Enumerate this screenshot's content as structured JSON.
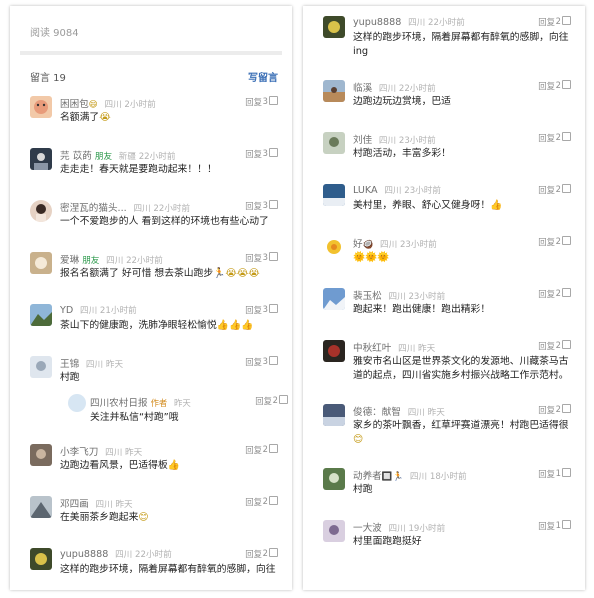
{
  "left": {
    "read_count": "阅读 9084",
    "comments_header": "留言 19",
    "write_label": "写留言",
    "comments": [
      {
        "name": "困困包",
        "name_emoji": "😄",
        "badge": "",
        "location": "四川",
        "time": "2小时前",
        "reply": "回复",
        "likes": "3",
        "text": "名额满了",
        "emoji": "😭"
      },
      {
        "name": "芫 苡菂",
        "name_emoji": "",
        "badge": "朋友",
        "location": "新疆",
        "time": "22小时前",
        "reply": "回复",
        "likes": "3",
        "text": "走走走！春天就是要跑动起来！！！",
        "emoji": ""
      },
      {
        "name": "密涅瓦的猫头...",
        "name_emoji": "",
        "badge": "",
        "location": "四川",
        "time": "22小时前",
        "reply": "回复",
        "likes": "3",
        "text": "一个不爱跑步的人 看到这样的环境也有些心动了",
        "emoji": ""
      },
      {
        "name": "爱琳",
        "name_emoji": "",
        "badge": "朋友",
        "location": "四川",
        "time": "22小时前",
        "reply": "回复",
        "likes": "3",
        "text": "报名名额满了 好可惜 想去茶山跑步",
        "emoji": "🏃😭😭😭"
      },
      {
        "name": "YD",
        "name_emoji": "",
        "badge": "",
        "location": "四川",
        "time": "21小时前",
        "reply": "回复",
        "likes": "3",
        "text": "茶山下的健康跑，洗肺净眼轻松愉悦",
        "emoji": "👍👍👍"
      },
      {
        "name": "王锦",
        "name_emoji": "",
        "badge": "",
        "location": "四川",
        "time": "昨天",
        "reply": "回复",
        "likes": "3",
        "text": "村跑",
        "emoji": ""
      },
      {
        "name": "小李飞刀",
        "name_emoji": "",
        "badge": "",
        "location": "四川",
        "time": "昨天",
        "reply": "回复",
        "likes": "2",
        "text": "边跑边看风景，巴适得板",
        "emoji": "👍"
      },
      {
        "name": "邓四画",
        "name_emoji": "",
        "badge": "",
        "location": "四川",
        "time": "昨天",
        "reply": "回复",
        "likes": "2",
        "text": "在美丽茶乡跑起来",
        "emoji": "😊"
      },
      {
        "name": "yupu8888",
        "name_emoji": "",
        "badge": "",
        "location": "四川",
        "time": "22小时前",
        "reply": "回复",
        "likes": "2",
        "text": "这样的跑步环境，隔着屏幕都有醉氧的感脚，向往",
        "emoji": ""
      }
    ],
    "subreply": {
      "name": "四川农村日报",
      "badge": "作者",
      "time": "昨天",
      "reply": "回复",
      "likes": "2",
      "text": "关注并私信“村跑”哦"
    }
  },
  "right": {
    "comments": [
      {
        "name": "yupu8888",
        "name_emoji": "",
        "badge": "",
        "location": "四川",
        "time": "22小时前",
        "reply": "回复",
        "likes": "2",
        "text": "这样的跑步环境，隔着屏幕都有醉氧的感脚，向往ing",
        "emoji": ""
      },
      {
        "name": "临溪",
        "name_emoji": "",
        "badge": "",
        "location": "四川",
        "time": "22小时前",
        "reply": "回复",
        "likes": "2",
        "text": "边跑边玩边赏境，巴适",
        "emoji": ""
      },
      {
        "name": "刘佳",
        "name_emoji": "",
        "badge": "",
        "location": "四川",
        "time": "23小时前",
        "reply": "回复",
        "likes": "2",
        "text": "村跑活动，丰富多彩！",
        "emoji": ""
      },
      {
        "name": "LUKA",
        "name_emoji": "",
        "badge": "",
        "location": "四川",
        "time": "23小时前",
        "reply": "回复",
        "likes": "2",
        "text": "美村里，养眼、舒心又健身呀！",
        "emoji": "👍"
      },
      {
        "name": "好",
        "name_emoji": "🥥",
        "badge": "",
        "location": "四川",
        "time": "23小时前",
        "reply": "回复",
        "likes": "2",
        "text": "",
        "emoji": "🌞🌞🌞"
      },
      {
        "name": "裴玉松",
        "name_emoji": "",
        "badge": "",
        "location": "四川",
        "time": "23小时前",
        "reply": "回复",
        "likes": "2",
        "text": "跑起来！跑出健康！跑出精彩！",
        "emoji": ""
      },
      {
        "name": "中秋红叶",
        "name_emoji": "",
        "badge": "",
        "location": "四川",
        "time": "昨天",
        "reply": "回复",
        "likes": "2",
        "text": "雅安市名山区是世界茶文化的发源地、川藏茶马古道的起点，四川省实施乡村振兴战略工作示范村。",
        "emoji": ""
      },
      {
        "name": "俊德：献智",
        "name_emoji": "",
        "badge": "",
        "location": "四川",
        "time": "昨天",
        "reply": "回复",
        "likes": "2",
        "text": "家乡的茶叶飘香，红草坪赛道漂亮！村跑巴适得很",
        "emoji": "😊"
      },
      {
        "name": "动养者",
        "name_emoji": "🔲🏃",
        "badge": "",
        "location": "四川",
        "time": "18小时前",
        "reply": "回复",
        "likes": "1",
        "text": "村跑",
        "emoji": ""
      },
      {
        "name": "一大波",
        "name_emoji": "",
        "badge": "",
        "location": "四川",
        "time": "19小时前",
        "reply": "回复",
        "likes": "1",
        "text": "村里面跑跑挺好",
        "emoji": ""
      }
    ]
  },
  "colors": {
    "accent_link": "#3b6fb6",
    "badge_friend": "#2e9a4d",
    "badge_author": "#d2891a",
    "text": "#222222",
    "meta": "#b2b2b2"
  }
}
